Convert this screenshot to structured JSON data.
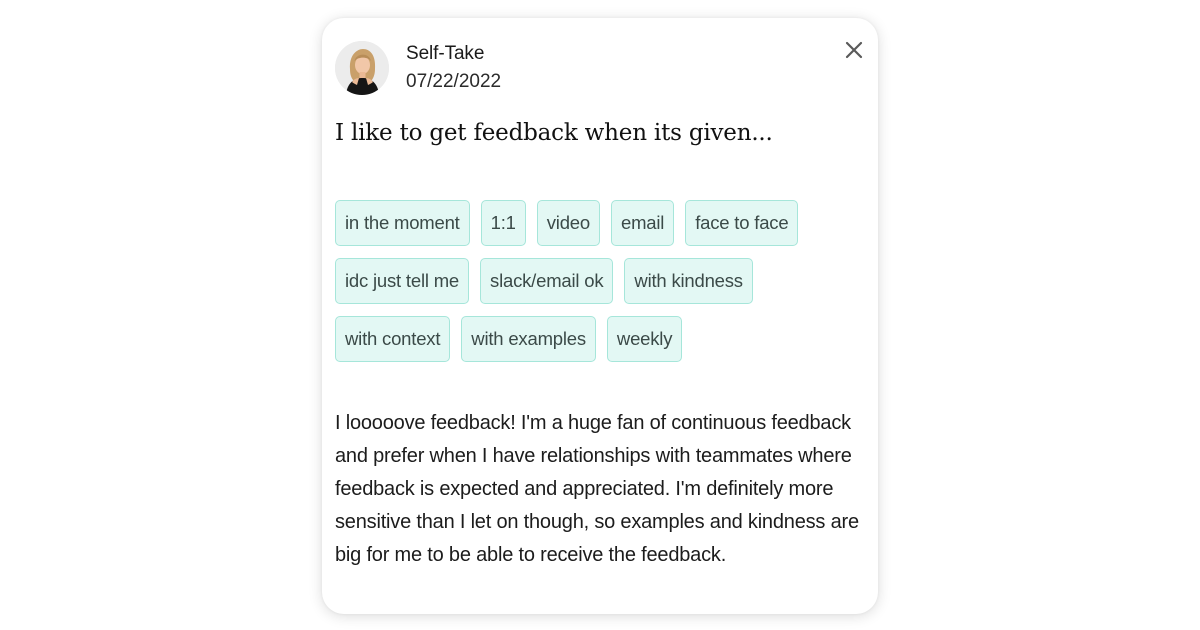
{
  "post": {
    "author": "Self-Take",
    "date": "07/22/2022",
    "avatar_icon": "person-avatar",
    "close_icon": "close-icon",
    "title": "I like to get feedback when its given...",
    "tag_rows": [
      [
        "in the moment",
        "1:1",
        "video",
        "email",
        "face to face"
      ],
      [
        "idc just tell me",
        "slack/email ok",
        "with kindness"
      ],
      [
        "with context",
        "with examples",
        "weekly"
      ]
    ],
    "body": "I looooove feedback! I'm a huge fan of continuous feedback and prefer when I have relationships with teammates where feedback is expected and appreciated. I'm definitely more sensitive than I let on though, so examples and kindness are big for me to be able to receive the feedback."
  },
  "colors": {
    "tag_background": "#e3f8f4",
    "tag_border": "#a6e6da",
    "tag_text": "#3b4a48"
  }
}
